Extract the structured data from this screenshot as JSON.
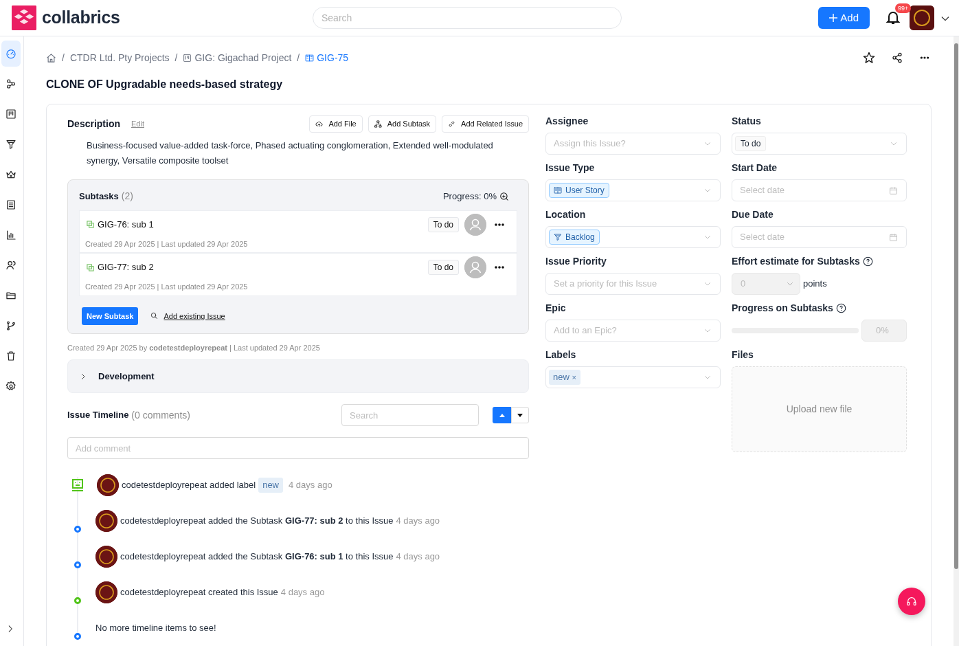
{
  "header": {
    "brand": "collabrics",
    "search": {
      "placeholder": "Search"
    },
    "add_button": "Add",
    "notifications_badge": "99+"
  },
  "sidebar": {
    "items": [
      {
        "kind": "dashboard",
        "selected": true
      },
      {
        "kind": "workflow",
        "selected": false
      },
      {
        "kind": "board",
        "selected": false
      },
      {
        "kind": "backlog",
        "selected": false
      },
      {
        "kind": "crown",
        "selected": false
      },
      {
        "kind": "list",
        "selected": false
      },
      {
        "kind": "reports",
        "selected": false
      },
      {
        "kind": "people",
        "selected": false
      },
      {
        "kind": "folder",
        "selected": false
      },
      {
        "kind": "branch",
        "selected": false
      },
      {
        "kind": "trash",
        "selected": false
      },
      {
        "kind": "settings",
        "selected": false
      }
    ]
  },
  "breadcrumb": [
    {
      "kind": "home"
    },
    {
      "kind": "separator",
      "text": "/"
    },
    {
      "kind": "text",
      "text": "CTDR Ltd. Pty Projects",
      "current": false
    },
    {
      "kind": "separator",
      "text": "/"
    },
    {
      "kind": "board",
      "text": "GIG: Gigachad Project",
      "current": false
    },
    {
      "kind": "separator",
      "text": "/"
    },
    {
      "kind": "story",
      "text": "GIG-75",
      "current": true
    }
  ],
  "title": "CLONE OF Upgradable needs-based strategy",
  "description": {
    "label": "Description",
    "edit": "Edit",
    "actions": [
      {
        "kind": "upload",
        "text": "Add File"
      },
      {
        "kind": "hierarchy",
        "text": "Add Subtask"
      },
      {
        "kind": "link",
        "text": "Add Related Issue"
      }
    ],
    "text": "Business-focused value-added task-force, Phased actuating conglomeration, Extended well-modulated synergy, Versatile composite toolset"
  },
  "subtasks": {
    "title": "Subtasks",
    "count": "(2)",
    "progress": "Progress: 0%",
    "items": [
      {
        "key": "GIG-76:",
        "name": "sub 1",
        "status": "To do",
        "meta": "Created 29 Apr 2025 | Last updated 29 Apr 2025"
      },
      {
        "key": "GIG-77:",
        "name": "sub 2",
        "status": "To do",
        "meta": "Created 29 Apr 2025 | Last updated 29 Apr 2025"
      }
    ],
    "new_button": "New Subtask",
    "add_existing": "Add existing Issue"
  },
  "created_line": "Created 29 Apr 2025 by **codetestdeployrepeat** | Last updated 29 Apr 2025",
  "development": {
    "title": "Development",
    "expanded": false
  },
  "timeline": {
    "title": "Issue Timeline",
    "count": "(0 comments)",
    "search": {
      "placeholder": "Search"
    },
    "comment": {
      "placeholder": "Add comment"
    },
    "items": [
      {
        "kind": "label",
        "color": "#52c41a",
        "text": "codetestdeployrepeat added label",
        "tag": "new",
        "time": "4 days ago"
      },
      {
        "kind": "event",
        "color": "#1677ff",
        "text": "codetestdeployrepeat added the Subtask **GIG-77: sub 2** to this Issue",
        "time": "4 days ago"
      },
      {
        "kind": "event",
        "color": "#1677ff",
        "text": "codetestdeployrepeat added the Subtask **GIG-76: sub 1** to this Issue",
        "time": "4 days ago"
      },
      {
        "kind": "event",
        "color": "#52c41a",
        "text": "codetestdeployrepeat created this Issue",
        "time": "4 days ago"
      },
      {
        "kind": "end",
        "color": "#1677ff",
        "text": "No more timeline items to see!"
      }
    ]
  },
  "fields_left": [
    {
      "kind": "select",
      "label": "Assignee",
      "placeholder": "Assign this Issue?"
    },
    {
      "kind": "story-tag",
      "label": "Issue Type",
      "value": "User Story"
    },
    {
      "kind": "backlog-tag",
      "label": "Location",
      "value": "Backlog"
    },
    {
      "kind": "select",
      "label": "Issue Priority",
      "placeholder": "Set a priority for this Issue"
    },
    {
      "kind": "select",
      "label": "Epic",
      "placeholder": "Add to an Epic?"
    },
    {
      "kind": "labels",
      "label": "Labels",
      "values": [
        {
          "text": "new",
          "remove": "×"
        }
      ]
    }
  ],
  "fields_right": [
    {
      "kind": "status",
      "label": "Status",
      "value": "To do"
    },
    {
      "kind": "date",
      "label": "Start Date",
      "placeholder": "Select date"
    },
    {
      "kind": "date",
      "label": "Due Date",
      "placeholder": "Select date"
    },
    {
      "kind": "number",
      "label": "Effort estimate for Subtasks",
      "help": true,
      "disabled": true,
      "value": "0",
      "suffix": "points"
    },
    {
      "kind": "progress",
      "label": "Progress on Subtasks",
      "help": true,
      "level": 0,
      "reading": "0%"
    },
    {
      "kind": "files",
      "label": "Files",
      "text": "Upload new file"
    }
  ]
}
